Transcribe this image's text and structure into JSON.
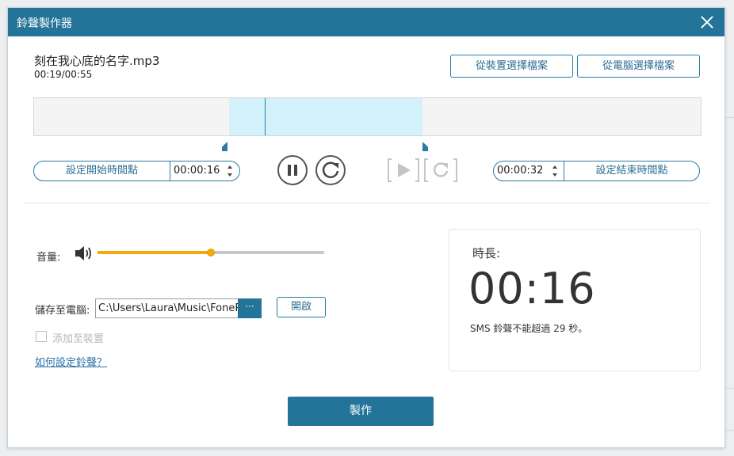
{
  "window": {
    "title": "鈴聲製作器"
  },
  "file": {
    "name": "刻在我心底的名字.mp3",
    "position": "00:19/00:55"
  },
  "buttons": {
    "from_device": "從裝置選擇檔案",
    "from_pc": "從電腦選擇檔案",
    "set_start": "設定開始時間點",
    "set_end": "設定結束時間點",
    "open": "開啟",
    "make": "製作",
    "browse": "···"
  },
  "range": {
    "start": "00:00:16",
    "end": "00:00:32"
  },
  "volume": {
    "label": "音量:",
    "level_fraction": 0.5
  },
  "save": {
    "label": "儲存至電腦:",
    "path": "C:\\Users\\Laura\\Music\\FoneP"
  },
  "add_to_device": {
    "label": "添加至裝置",
    "checked": false
  },
  "help_link": "如何設定鈴聲？",
  "duration": {
    "label": "時長:",
    "value": "00:16",
    "note": "SMS 鈴聲不能超過 29 秒。"
  },
  "colors": {
    "accent": "#237498",
    "volume": "#f4a80b",
    "selection": "#d3f1fb"
  },
  "icons": [
    "close-icon",
    "pause-icon",
    "replay-icon",
    "play-preview-icon",
    "replay-preview-icon",
    "speaker-icon"
  ]
}
